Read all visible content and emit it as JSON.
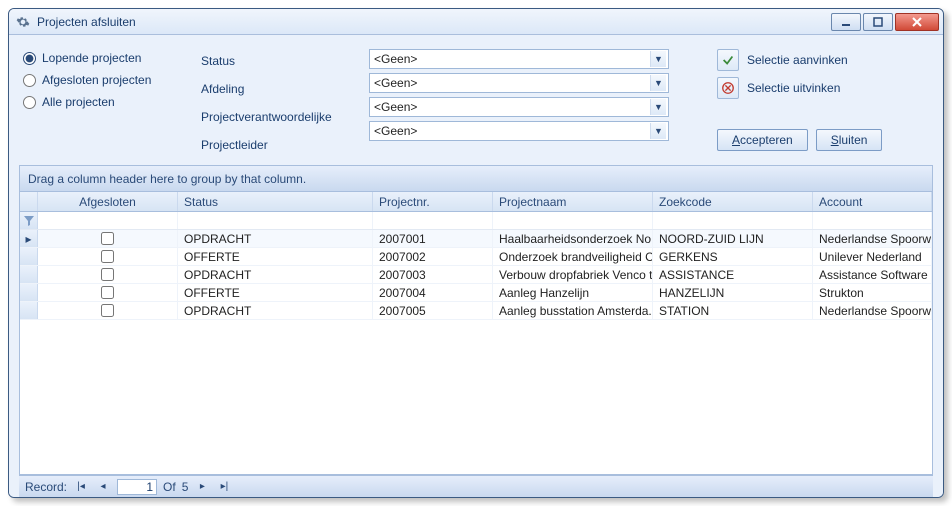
{
  "window": {
    "title": "Projecten afsluiten"
  },
  "radios": {
    "lopende": "Lopende projecten",
    "afgesloten": "Afgesloten projecten",
    "alle": "Alle projecten",
    "selected": "lopende"
  },
  "filters": {
    "status_label": "Status",
    "afdeling_label": "Afdeling",
    "verantw_label": "Projectverantwoordelijke",
    "leider_label": "Projectleider",
    "status_value": "<Geen>",
    "afdeling_value": "<Geen>",
    "verantw_value": "<Geen>",
    "leider_value": "<Geen>"
  },
  "actions": {
    "select_all": "Selectie aanvinken",
    "deselect_all": "Selectie uitvinken",
    "accept": "Accepteren",
    "close": "Sluiten"
  },
  "group_header": "Drag a column header here to group by that column.",
  "columns": {
    "afgesloten": "Afgesloten",
    "status": "Status",
    "projectnr": "Projectnr.",
    "projectnaam": "Projectnaam",
    "zoekcode": "Zoekcode",
    "account": "Account"
  },
  "rows": [
    {
      "afgesloten": false,
      "status": "OPDRACHT",
      "projectnr": "2007001",
      "projectnaam": "Haalbaarheidsonderzoek No..",
      "zoekcode": "NOORD-ZUID LIJN",
      "account": "Nederlandse Spoorwegen"
    },
    {
      "afgesloten": false,
      "status": "OFFERTE",
      "projectnr": "2007002",
      "projectnaam": "Onderzoek brandveiligheid C..",
      "zoekcode": "GERKENS",
      "account": "Unilever Nederland"
    },
    {
      "afgesloten": false,
      "status": "OPDRACHT",
      "projectnr": "2007003",
      "projectnaam": "Verbouw dropfabriek Venco t..",
      "zoekcode": "ASSISTANCE",
      "account": "Assistance Software"
    },
    {
      "afgesloten": false,
      "status": "OFFERTE",
      "projectnr": "2007004",
      "projectnaam": "Aanleg Hanzelijn",
      "zoekcode": "HANZELIJN",
      "account": "Strukton"
    },
    {
      "afgesloten": false,
      "status": "OPDRACHT",
      "projectnr": "2007005",
      "projectnaam": "Aanleg busstation Amsterda..",
      "zoekcode": "STATION",
      "account": "Nederlandse Spoorwegen"
    }
  ],
  "record_nav": {
    "label": "Record:",
    "current": "1",
    "of": "Of",
    "total": "5"
  }
}
